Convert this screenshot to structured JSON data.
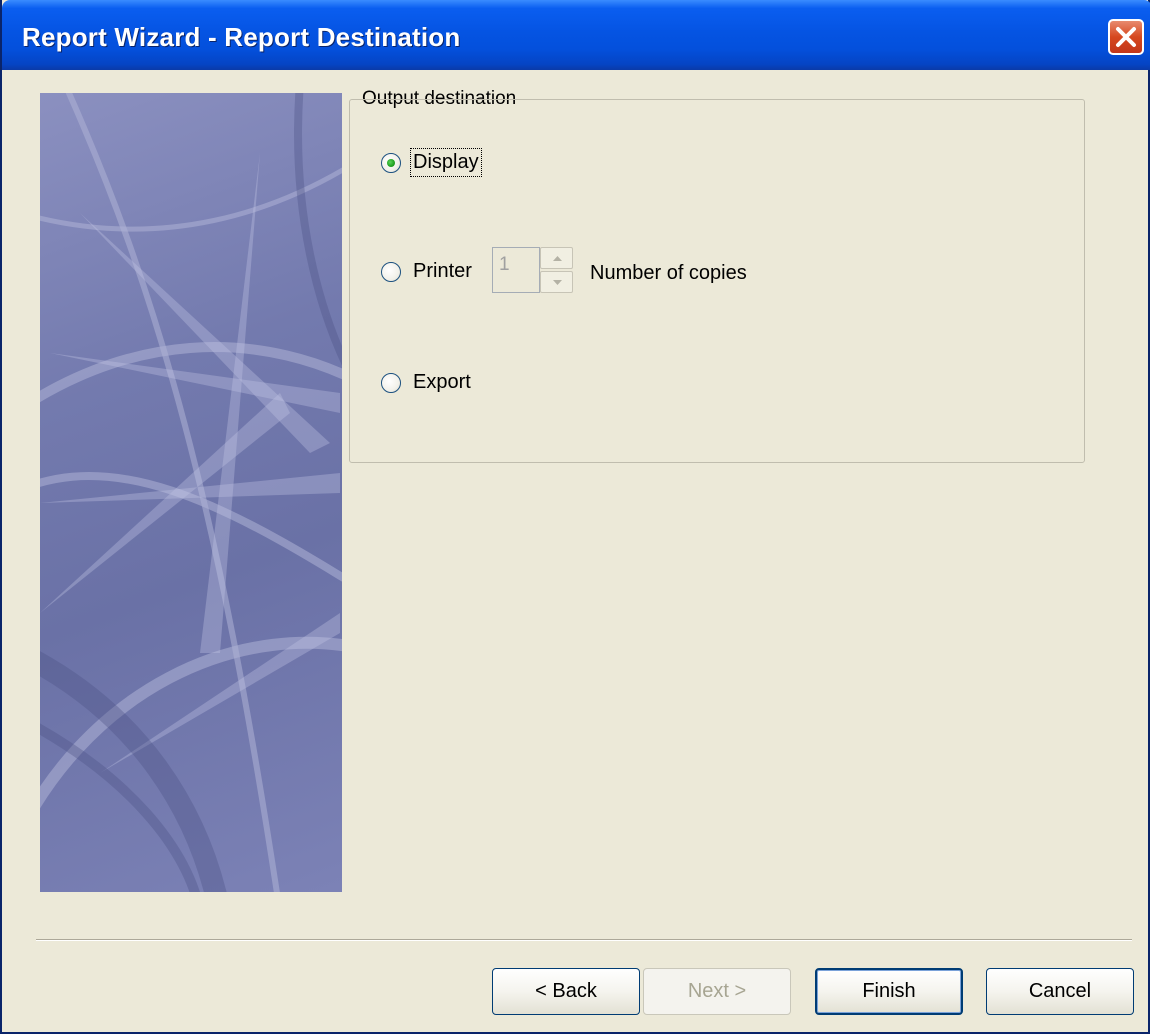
{
  "window": {
    "title": "Report Wizard - Report Destination",
    "close_icon": "close-icon"
  },
  "output_group": {
    "legend": "Output destination",
    "options": [
      {
        "label": "Display",
        "selected": true
      },
      {
        "label": "Printer",
        "selected": false
      },
      {
        "label": "Export",
        "selected": false
      }
    ],
    "copies_value": "1",
    "copies_label": "Number of copies"
  },
  "buttons": {
    "back": "< Back",
    "next": "Next >",
    "finish": "Finish",
    "cancel": "Cancel"
  },
  "colors": {
    "titlebar": "#0554e3",
    "dialog_bg": "#ece9d8",
    "close_button": "#d6481f",
    "radio_dot": "#21a121"
  }
}
